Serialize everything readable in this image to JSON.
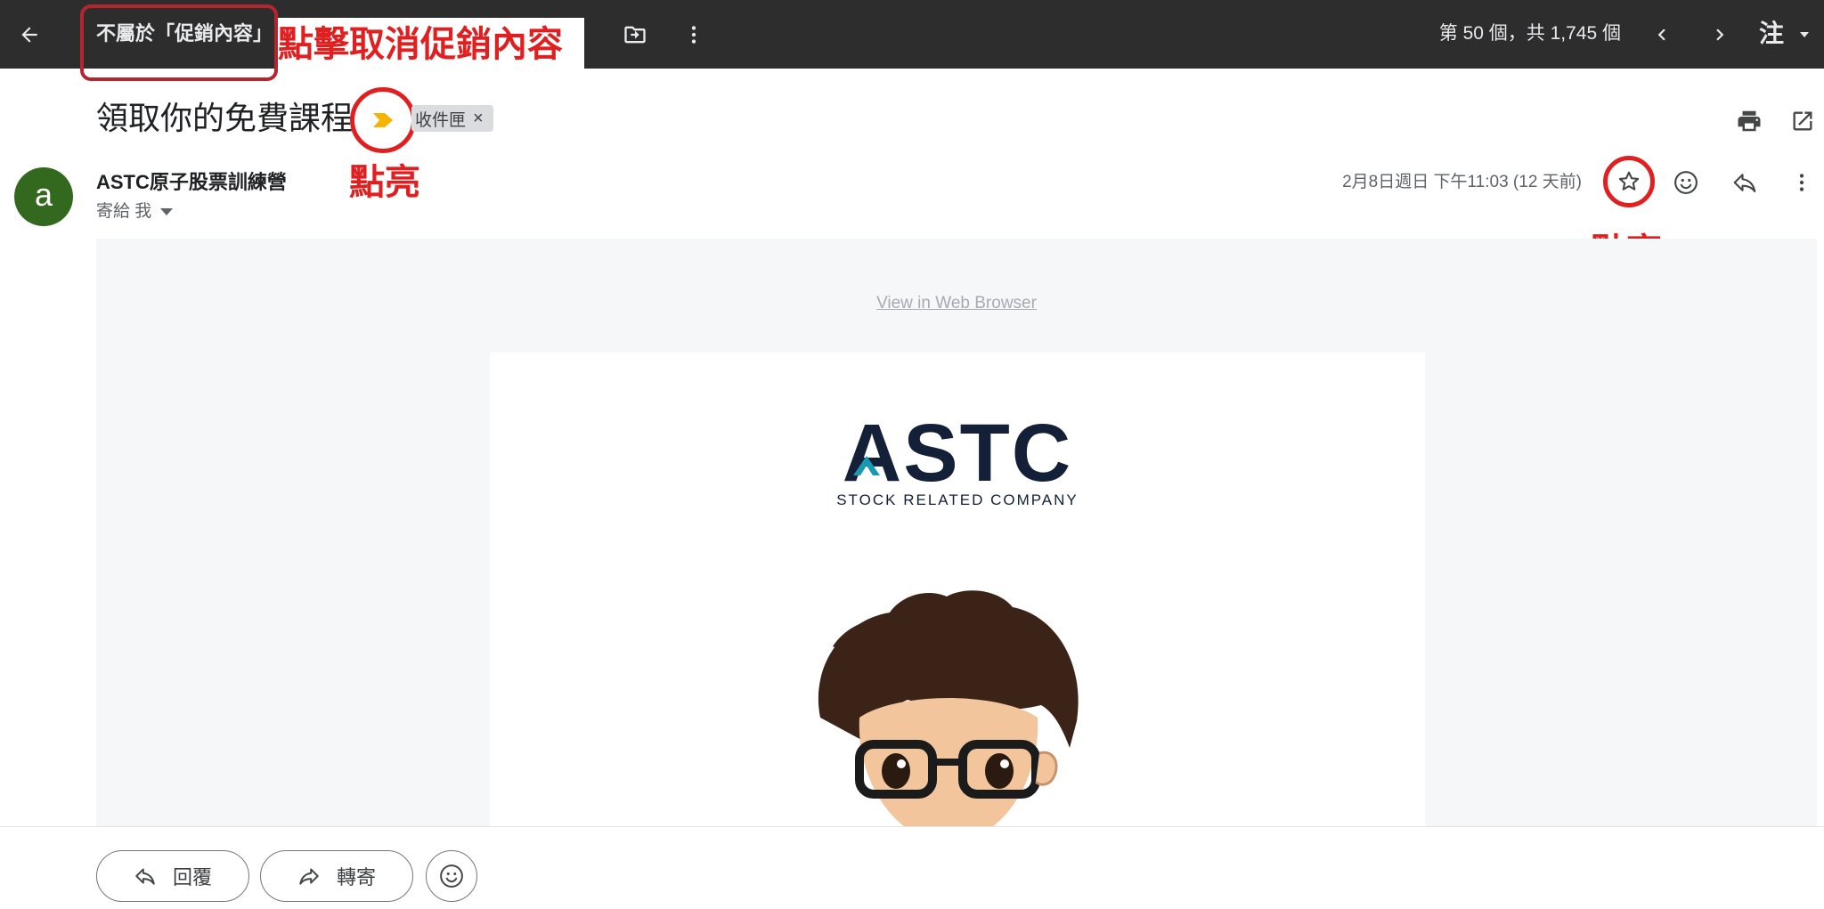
{
  "toolbar": {
    "not_promo_label": "不屬於「促銷內容」",
    "annotation": "點擊取消促銷內容",
    "pager_text": "第 50 個，共 1,745 個",
    "account_char": "注"
  },
  "subject": {
    "title": "領取你的免費課程",
    "label_chip": "收件匣",
    "label_remove": "×",
    "annotation": "點亮"
  },
  "sender": {
    "avatar_letter": "a",
    "name": "ASTC原子股票訓練營",
    "recipient": "寄給 我",
    "date": "2月8日週日 下午11:03 (12 天前)",
    "annotation": "點亮"
  },
  "email": {
    "web_link": "View in Web Browser",
    "logo_main": "ASTC",
    "logo_tagline": "STOCK RELATED COMPANY"
  },
  "actions": {
    "reply": "回覆",
    "forward": "轉寄"
  },
  "colors": {
    "toolbar_bg": "#2d2d2d",
    "annotation_red": "#e02020",
    "importance_yellow": "#f4b400",
    "avatar_green": "#33691e",
    "logo_navy": "#132037",
    "logo_teal": "#1a9ab0"
  },
  "icons": [
    "back-arrow-icon",
    "move-to-folder-icon",
    "more-vert-icon",
    "chevron-left-icon",
    "chevron-right-icon",
    "caret-down-icon",
    "importance-marker-icon",
    "print-icon",
    "open-in-new-icon",
    "star-icon",
    "emoji-icon",
    "reply-icon",
    "forward-icon"
  ]
}
